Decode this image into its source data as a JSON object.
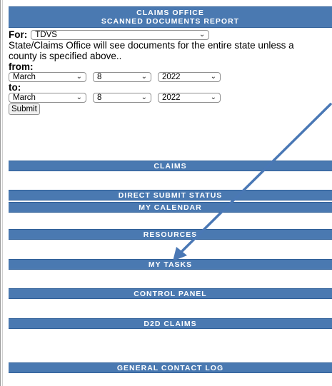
{
  "report": {
    "title_line1": "CLAIMS OFFICE",
    "title_line2": "SCANNED DOCUMENTS REPORT"
  },
  "form": {
    "for_label": "For:",
    "for_value": "TDVS",
    "description": "State/Claims Office will see documents for the entire state unless a county is specified above..",
    "from_label": "from:",
    "from_month": "March",
    "from_day": "8",
    "from_year": "2022",
    "to_label": "to:",
    "to_month": "March",
    "to_day": "8",
    "to_year": "2022",
    "submit_label": "Submit"
  },
  "nav": {
    "items": [
      {
        "label": "CLAIMS"
      },
      {
        "label": "DIRECT SUBMIT STATUS"
      },
      {
        "label": "MY CALENDAR"
      },
      {
        "label": "RESOURCES"
      },
      {
        "label": "MY TASKS"
      },
      {
        "label": "CONTROL PANEL"
      },
      {
        "label": "D2D CLAIMS"
      },
      {
        "label": "GENERAL CONTACT LOG"
      }
    ]
  },
  "annotation": {
    "arrow_color": "#4a78b5",
    "points_to": "MY TASKS"
  },
  "colors": {
    "bar_blue": "#4a79b1",
    "bar_border": "#2f5f98"
  }
}
